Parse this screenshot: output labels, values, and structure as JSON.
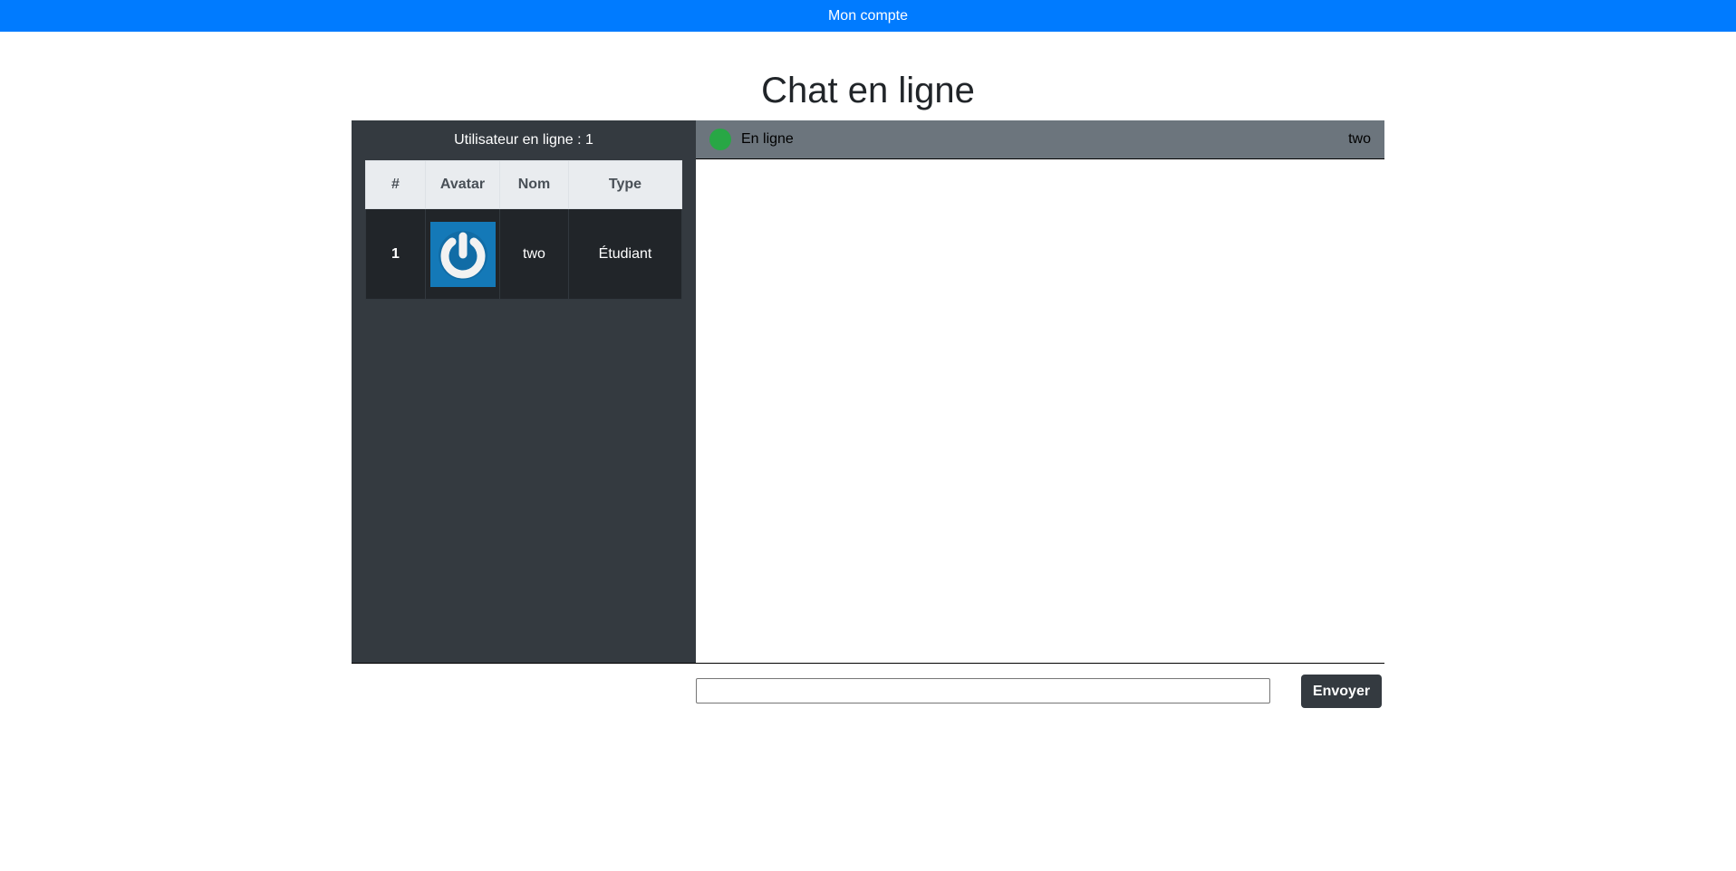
{
  "topbar": {
    "link_label": "Mon compte"
  },
  "page": {
    "title": "Chat en ligne"
  },
  "sidebar": {
    "online_count_label": "Utilisateur en ligne : 1",
    "table": {
      "headers": [
        "#",
        "Avatar",
        "Nom",
        "Type"
      ],
      "rows": [
        {
          "index": "1",
          "avatar": "power-icon",
          "name": "two",
          "type": "Étudiant"
        }
      ]
    }
  },
  "chat": {
    "status_label": "En ligne",
    "status_color": "#28a745",
    "peer_name": "two",
    "input": {
      "value": "",
      "placeholder": ""
    },
    "send_label": "Envoyer"
  },
  "colors": {
    "topbar": "#007bff",
    "sidebar": "#343a40",
    "chat_header": "#6c757d",
    "avatar_bg": "#1479b8"
  }
}
